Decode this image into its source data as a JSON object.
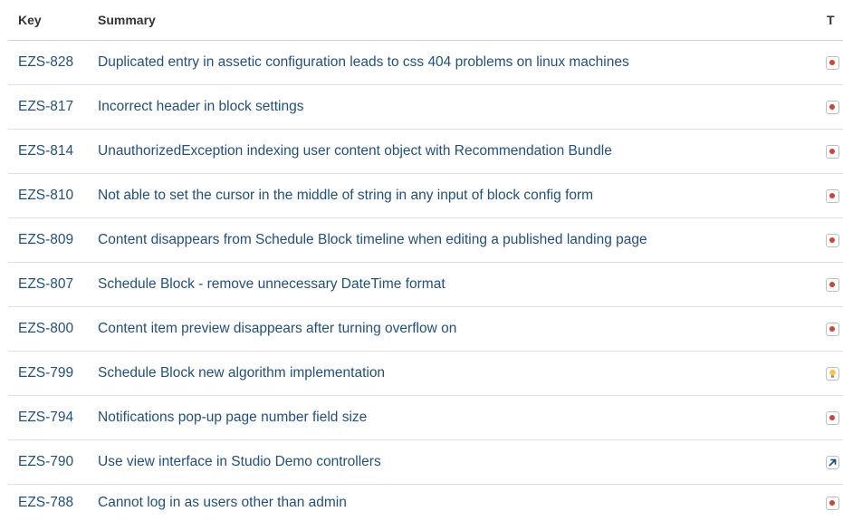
{
  "table": {
    "headers": {
      "key": "Key",
      "summary": "Summary",
      "type": "T"
    },
    "rows": [
      {
        "key": "EZS-828",
        "summary": "Duplicated entry in assetic configuration leads to css 404 problems on linux machines",
        "type": "bug-icon"
      },
      {
        "key": "EZS-817",
        "summary": "Incorrect header in block settings",
        "type": "bug-icon"
      },
      {
        "key": "EZS-814",
        "summary": "UnauthorizedException indexing user content object with Recommendation Bundle",
        "type": "bug-icon"
      },
      {
        "key": "EZS-810",
        "summary": "Not able to set the cursor in the middle of string in any input of block config form",
        "type": "bug-icon"
      },
      {
        "key": "EZS-809",
        "summary": "Content disappears from Schedule Block timeline when editing a published landing page",
        "type": "bug-icon"
      },
      {
        "key": "EZS-807",
        "summary": "Schedule Block - remove unnecessary DateTime format",
        "type": "bug-icon"
      },
      {
        "key": "EZS-800",
        "summary": "Content item preview disappears after turning overflow on",
        "type": "bug-icon"
      },
      {
        "key": "EZS-799",
        "summary": "Schedule Block new algorithm implementation",
        "type": "lightbulb-icon"
      },
      {
        "key": "EZS-794",
        "summary": "Notifications pop-up page number field size",
        "type": "bug-icon"
      },
      {
        "key": "EZS-790",
        "summary": "Use view interface in Studio Demo controllers",
        "type": "improvement-arrow-icon"
      },
      {
        "key": "EZS-788",
        "summary": "Cannot log in as users other than admin",
        "type": "bug-icon"
      }
    ]
  },
  "colors": {
    "link": "#205081",
    "bug": "#d04437",
    "lightbulb": "#f6c342",
    "improvement": "#205081"
  }
}
